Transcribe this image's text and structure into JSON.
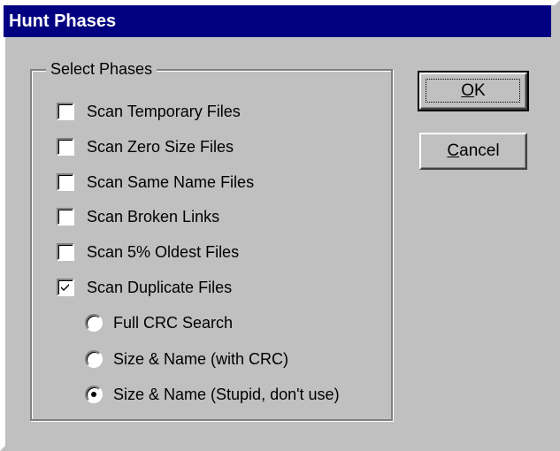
{
  "window": {
    "title": "Hunt Phases"
  },
  "group": {
    "legend": "Select Phases"
  },
  "checkboxes": [
    {
      "label": "Scan Temporary Files",
      "checked": false
    },
    {
      "label": "Scan Zero Size Files",
      "checked": false
    },
    {
      "label": "Scan Same Name Files",
      "checked": false
    },
    {
      "label": "Scan Broken Links",
      "checked": false
    },
    {
      "label": "Scan 5% Oldest Files",
      "checked": false
    },
    {
      "label": "Scan Duplicate Files",
      "checked": true
    }
  ],
  "radios": [
    {
      "label": "Full CRC Search",
      "selected": false
    },
    {
      "label": "Size & Name (with CRC)",
      "selected": false
    },
    {
      "label": "Size & Name (Stupid, don't use)",
      "selected": true
    }
  ],
  "buttons": {
    "ok_label": "OK",
    "cancel_label": "Cancel"
  },
  "colors": {
    "title_bar": "#000080",
    "face": "#c0c0c0"
  }
}
